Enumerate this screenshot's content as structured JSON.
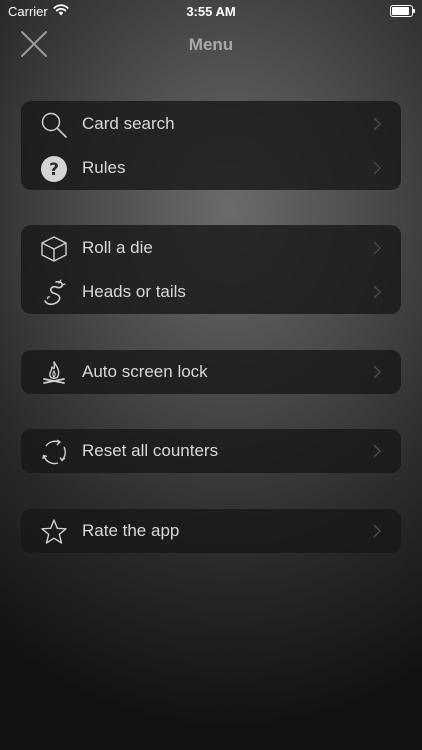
{
  "status_bar": {
    "carrier": "Carrier",
    "time": "3:55 AM",
    "battery_level": 1.0
  },
  "nav": {
    "title": "Menu",
    "close_icon": "close-icon"
  },
  "groups": [
    {
      "items": [
        {
          "label": "Card search",
          "icon": "search-icon"
        },
        {
          "label": "Rules",
          "icon": "question-icon"
        }
      ]
    },
    {
      "items": [
        {
          "label": "Roll a die",
          "icon": "die-cube-icon"
        },
        {
          "label": "Heads or tails",
          "icon": "dragon-icon"
        }
      ]
    },
    {
      "items": [
        {
          "label": "Auto screen lock",
          "icon": "campfire-icon"
        }
      ]
    },
    {
      "items": [
        {
          "label": "Reset all counters",
          "icon": "reset-arrows-icon"
        }
      ]
    },
    {
      "items": [
        {
          "label": "Rate the app",
          "icon": "star-icon"
        }
      ]
    }
  ],
  "colors": {
    "panel": "#181818",
    "text": "#d8d8d8",
    "title": "#a9a9a9",
    "chevron": "#4a4a4a"
  }
}
